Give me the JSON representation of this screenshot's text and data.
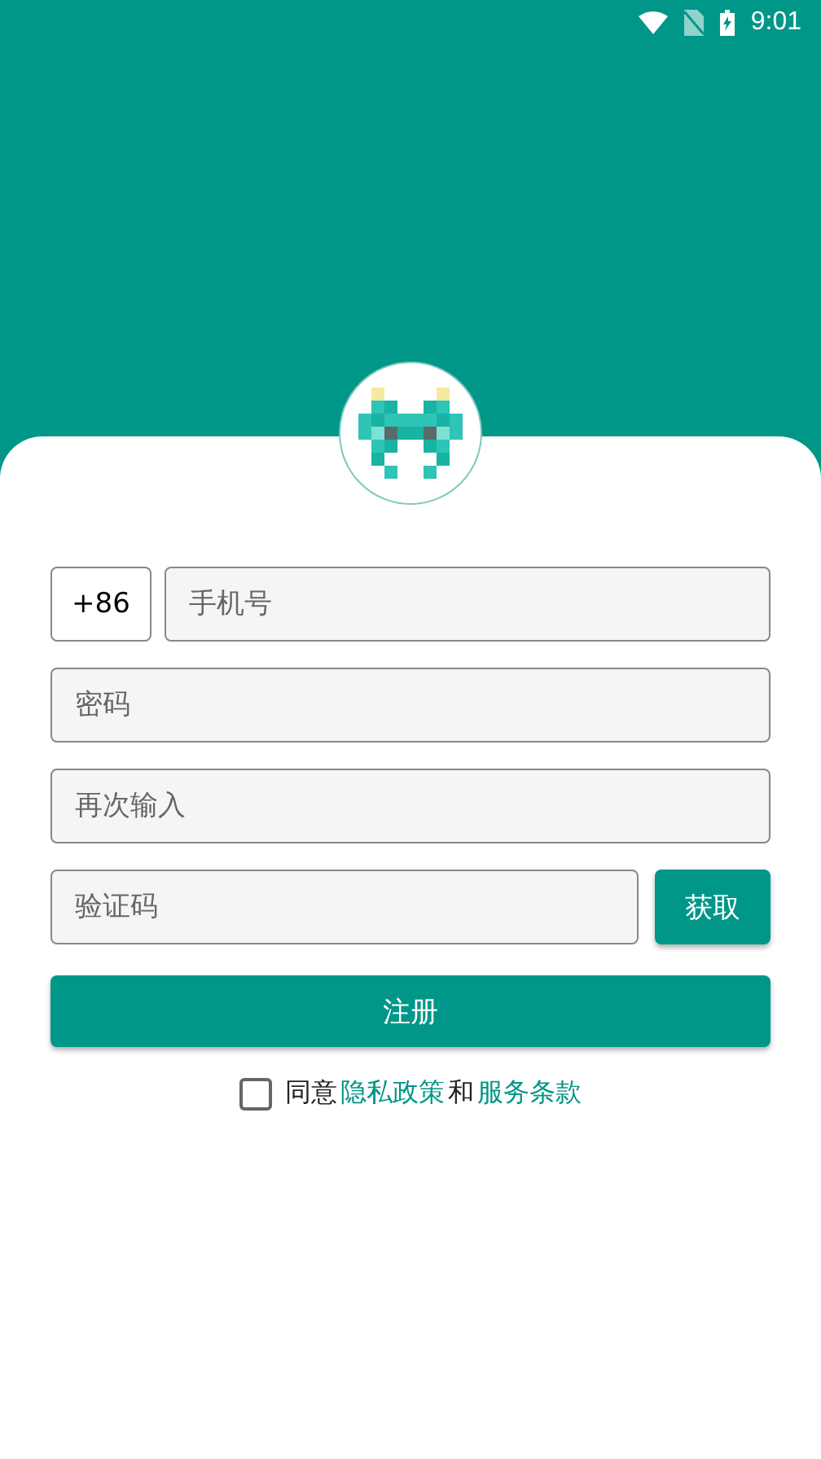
{
  "status_bar": {
    "time": "9:01"
  },
  "form": {
    "country_code": "+86",
    "phone": {
      "placeholder": "手机号"
    },
    "password": {
      "placeholder": "密码"
    },
    "repeat": {
      "placeholder": "再次输入"
    },
    "code": {
      "placeholder": "验证码"
    },
    "get_code_button": "获取",
    "register_button": "注册"
  },
  "agreement": {
    "checked": false,
    "prefix": "同意",
    "privacy_link": "隐私政策",
    "conjunction": "和",
    "terms_link": "服务条款"
  }
}
